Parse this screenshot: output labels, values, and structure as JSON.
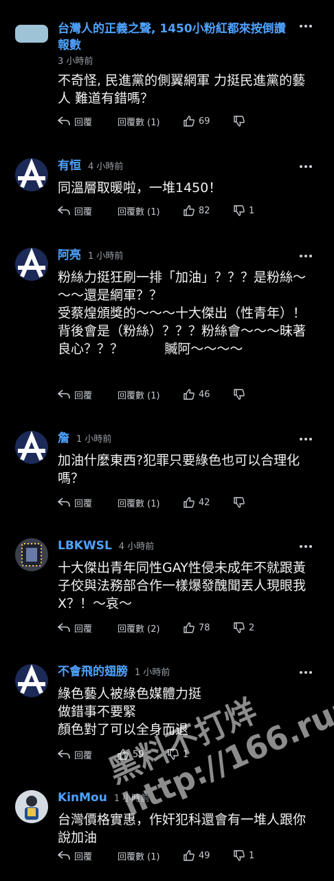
{
  "comments": [
    {
      "name": "台灣人的正義之聲, 1450小粉紅都來按倒讚報數",
      "time": "3 小時前",
      "text": "不奇怪, 民進黨的側翼網軍 力挺民進黨的藝人 難道有錯嗎？",
      "reply_label": "回覆",
      "reply_count_label": "回覆數 (1)",
      "likes": "69",
      "dislikes": ""
    },
    {
      "name": "有恒",
      "time": "4 小時前",
      "text": "同溫層取暖啦，一堆1450！",
      "reply_label": "回覆",
      "reply_count_label": "回覆數 (1)",
      "likes": "82",
      "dislikes": "1"
    },
    {
      "name": "阿亮",
      "time": "1 小時前",
      "text": "粉絲力挺狂刷一排「加油」？？？是粉絲～～～還是網軍？？\n受蔡煌頒獎的～～～十大傑出（性青年）！          背後會是（粉絲）？？？粉絲會～～～昧著良心？？？          贓阿～～～～",
      "reply_label": "回覆",
      "reply_count_label": "回覆數 (1)",
      "likes": "46",
      "dislikes": ""
    },
    {
      "name": "詹",
      "time": "1 小時前",
      "text": "加油什麼東西?犯罪只要綠色也可以合理化嗎？",
      "reply_label": "回覆",
      "reply_count_label": "回覆數 (1)",
      "likes": "42",
      "dislikes": ""
    },
    {
      "name": "LBKWSL",
      "time": "4 小時前",
      "text": "十大傑出青年同性GAY性侵未成年不就跟黃子佼與法務部合作一樣爆發醜聞丟人現眼我X？！～哀～",
      "reply_label": "回覆",
      "reply_count_label": "回覆數 (2)",
      "likes": "78",
      "dislikes": "2"
    },
    {
      "name": "不會飛的翅膀",
      "time": "1 小時前",
      "text": "綠色藝人被綠色媒體力挺\n做錯事不要緊\n顏色對了可以全身而退",
      "reply_label": "回覆",
      "reply_count_label": "",
      "likes": "59",
      "dislikes": "1"
    },
    {
      "name": "KinMou",
      "time": "1 小時前",
      "text": "台灣價格實惠，作奸犯科還會有一堆人跟你說加油",
      "reply_label": "回覆",
      "reply_count_label": "回覆數 (1)",
      "likes": "49",
      "dislikes": "1"
    }
  ],
  "watermark": {
    "line1": "黑料不打烊",
    "line2": "http://166.run"
  },
  "colors": {
    "background": "#000000",
    "name": "#4fa3ff",
    "meta": "#9aa0a6"
  }
}
